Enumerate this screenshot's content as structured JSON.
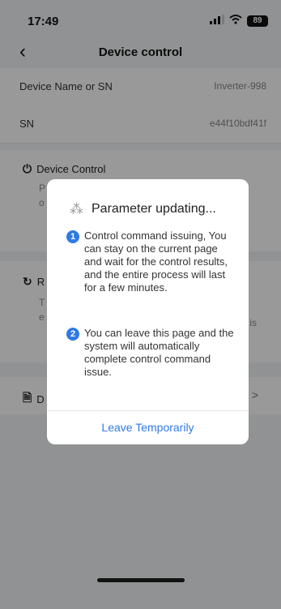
{
  "status_bar": {
    "time": "17:49",
    "battery": "89"
  },
  "nav": {
    "title": "Device control"
  },
  "info": [
    {
      "label": "Device Name or SN",
      "value": "Inverter-998"
    },
    {
      "label": "SN",
      "value": "e44f10bdf41f"
    }
  ],
  "sections": {
    "device_control": {
      "title": "Device Control",
      "desc_left_1": "P",
      "desc_left_2": "o"
    },
    "restart": {
      "title": "R",
      "desc_left_1": "T",
      "desc_left_2": "e",
      "desc_right": "nd is"
    },
    "record": {
      "title": "D"
    }
  },
  "modal": {
    "title": "Parameter updating...",
    "items": [
      {
        "badge": "1",
        "text": "Control command issuing, You can stay on the current page and wait for the control results, and the entire process will last for a few minutes."
      },
      {
        "badge": "2",
        "text": "You can leave this page and the system will automatically complete control command issue."
      }
    ],
    "leave_button": "Leave Temporarily"
  }
}
